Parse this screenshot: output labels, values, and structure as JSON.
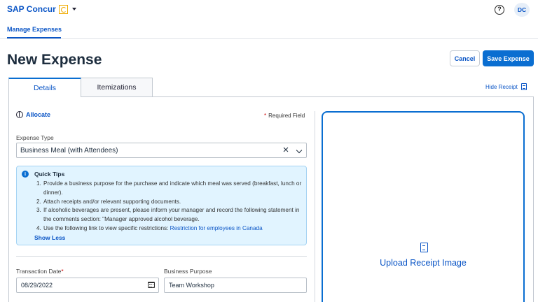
{
  "header": {
    "brand": "SAP Concur",
    "help_icon": "help-circle-icon",
    "avatar_initials": "DC"
  },
  "nav": {
    "active_tab": "Manage Expenses"
  },
  "page": {
    "title": "New Expense",
    "cancel_label": "Cancel",
    "save_label": "Save Expense"
  },
  "tabs": [
    {
      "label": "Details",
      "active": true
    },
    {
      "label": "Itemizations",
      "active": false
    }
  ],
  "hide_receipt_label": "Hide Receipt",
  "form": {
    "allocate_label": "Allocate",
    "required_star": "*",
    "required_note": "Required Field",
    "expense_type_label": "Expense Type",
    "expense_type_value": "Business Meal (with Attendees)",
    "quick_tips": {
      "title": "Quick Tips",
      "items": [
        {
          "num": "1.",
          "text": "Provide a business purpose for the purchase and indicate which meal was served (breakfast, lunch or dinner)."
        },
        {
          "num": "2.",
          "text": "Attach receipts and/or relevant supporting documents."
        },
        {
          "num": "3.",
          "text": "If alcoholic beverages are present, please inform your manager and record the following statement in the comments section: \"Manager approved alcohol beverage."
        },
        {
          "num": "4.",
          "text": "Use the following link to view specific restrictions: ",
          "link": "Restriction for employees in Canada"
        }
      ],
      "show_less": "Show Less"
    },
    "transaction_date_label": "Transaction Date",
    "transaction_date_value": "08/29/2022",
    "business_purpose_label": "Business Purpose",
    "business_purpose_value": "Team Workshop"
  },
  "receipt": {
    "upload_label": "Upload Receipt Image"
  },
  "colors": {
    "primary": "#0a6ed1",
    "link": "#0a55c6",
    "tips_bg": "#e1f4ff",
    "required": "#cc0000"
  }
}
